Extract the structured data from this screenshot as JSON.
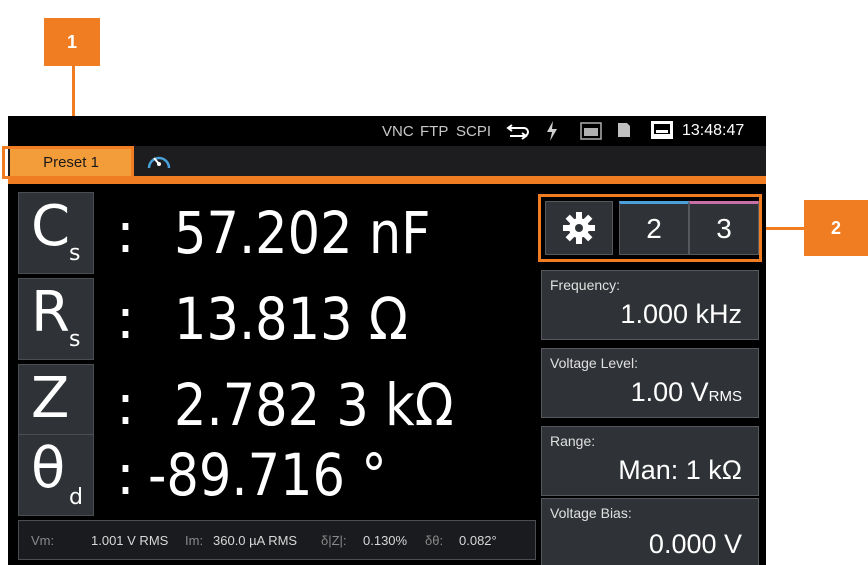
{
  "callouts": {
    "one": "1",
    "two": "2"
  },
  "statusbar": {
    "vnc": "VNC",
    "ftp": "FTP",
    "scpi": "SCPI",
    "sync_icon": "sync-icon",
    "power_icon": "lightning-icon",
    "log_icon": "log-icon",
    "storage_icon": "memory-card-icon",
    "network_icon": "network-icon",
    "time": "13:48:47"
  },
  "tabs": {
    "preset": "Preset 1",
    "gauge_icon": "gauge-icon"
  },
  "measurements": [
    {
      "symbol": "C",
      "sub": "s",
      "colon": ":",
      "value": "57.202 nF"
    },
    {
      "symbol": "R",
      "sub": "s",
      "colon": ":",
      "value": "13.813 Ω"
    },
    {
      "symbol": "Z",
      "sub": "",
      "colon": ":",
      "value": "2.782 3 kΩ"
    },
    {
      "symbol": "θ",
      "sub": "d",
      "colon": ":",
      "value": "-89.716 °"
    }
  ],
  "infobar": {
    "vm_label": "Vm:",
    "vm_value": "1.001 V RMS",
    "im_label": "Im:",
    "im_value": "360.0 µA RMS",
    "dz_label": "δ|Z|:",
    "dz_value": "0.130%",
    "dtheta_label": "δθ:",
    "dtheta_value": "0.082°"
  },
  "buttons": {
    "settings_icon": "gear-icon",
    "b2": "2",
    "b3": "3"
  },
  "panel": {
    "frequency": {
      "label": "Frequency:",
      "value": "1.000 kHz"
    },
    "voltage_level": {
      "label": "Voltage Level:",
      "value": "1.00 V",
      "unit": "RMS"
    },
    "range": {
      "label": "Range:",
      "value": "Man: 1 kΩ"
    },
    "voltage_bias": {
      "label": "Voltage Bias:",
      "value": "0.000 V"
    }
  },
  "colors": {
    "accent": "#f07d21",
    "tab": "#f39c3a",
    "panel": "#2f3236",
    "btn2_bar": "#4aa0d8",
    "btn3_bar": "#c86fa8"
  }
}
